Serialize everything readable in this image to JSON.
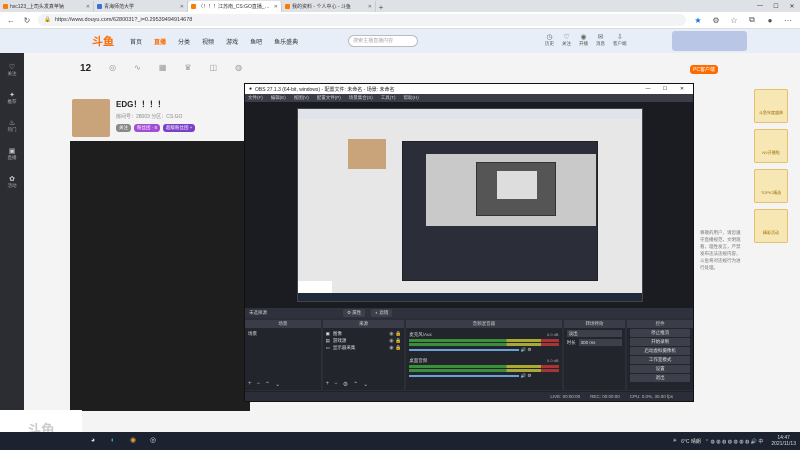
{
  "browser": {
    "tabs": [
      {
        "label": "hxc123_上司头发真苹钠",
        "active": false
      },
      {
        "label": "青海师范大学",
        "active": false
      },
      {
        "label": "〈！！！江苏南_CS:GO直播_斗鱼直",
        "active": true
      },
      {
        "label": "我的资料 - 个人中心 - 斗鱼",
        "active": false
      }
    ],
    "url": "https://www.douyu.com/6280031?_i=0.29539494914678"
  },
  "site": {
    "logo": "斗鱼",
    "nav": [
      "首页",
      "直播",
      "分类",
      "视频",
      "游戏",
      "鱼吧",
      "鱼乐盛典"
    ],
    "search_placeholder": "搜索主播直播内容",
    "top_icons": [
      "历史",
      "关注",
      "开播",
      "消息",
      "客户端"
    ],
    "cat_count": "12",
    "anchor_name": "EDG！！！！",
    "anchor_sub": "房间号：28003 分区：CS:GO",
    "anchor_tags": [
      "关注",
      "粉丝团 · 8",
      "超级粉丝团 +"
    ],
    "sidebar": [
      "关注",
      "推荐",
      "热门",
      "直播",
      "活动"
    ],
    "right_pill": "PC客户端",
    "right_text": "尊敬的用户，请您遵守直播规范，文明观看，理性发言，严禁发布违法违规内容，斗鱼将对违规行为进行处理。",
    "ads": [
      "斗鱼年度盛典",
      "NV开播啦",
      "TOPIC精选",
      "精彩活动"
    ],
    "watermark": "斗鱼"
  },
  "obs": {
    "title": "OBS 27.1.3 (64-bit, windows) - 配置文件: 未命名 - 场景: 未命名",
    "menu": [
      "文件(F)",
      "编辑(E)",
      "视图(V)",
      "配置文件(P)",
      "场景集合(S)",
      "工具(T)",
      "帮助(H)"
    ],
    "toolbar_label": "未选择源",
    "toolbar_buttons": [
      "属性",
      "滤镜"
    ],
    "docks": {
      "scenes": {
        "title": "场景",
        "items": [
          "场景"
        ]
      },
      "sources": {
        "title": "来源",
        "items": [
          "图像",
          "游戏源",
          "显示器采集"
        ]
      },
      "mixer": {
        "title": "音频混音器",
        "channels": [
          {
            "name": "麦克风/Aux",
            "db": "0.0 dB"
          },
          {
            "name": "桌面音频",
            "db": "0.0 dB"
          }
        ]
      },
      "transitions": {
        "title": "转场特效",
        "type": "淡出",
        "duration_label": "时长",
        "duration": "300 ms"
      },
      "controls": {
        "title": "控件",
        "buttons": [
          "停止推流",
          "开始录制",
          "启动虚拟摄像机",
          "工作室模式",
          "设置",
          "退出"
        ]
      }
    },
    "status": [
      "LIVE: 00:00:00",
      "REC: 00:00:00",
      "CPU: 0.0%, 30.00 fps"
    ]
  },
  "taskbar": {
    "weather": "6°C 晴朗",
    "time": "14:47",
    "date": "2021/11/13"
  }
}
